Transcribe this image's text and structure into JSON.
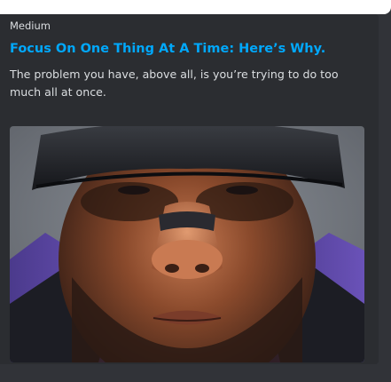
{
  "embed": {
    "provider": "Medium",
    "title": "Focus On One Thing At A Time: Here’s Why.",
    "description": "The problem you have, above all, is you’re trying to do too much all at once.",
    "image_subject": "close-up portrait of a man wearing a black skull cap and nose strip, purple jersey"
  },
  "colors": {
    "background": "#313338",
    "embed_background": "#2b2d31",
    "title_link": "#00a8fc",
    "text": "#dbdee1"
  }
}
